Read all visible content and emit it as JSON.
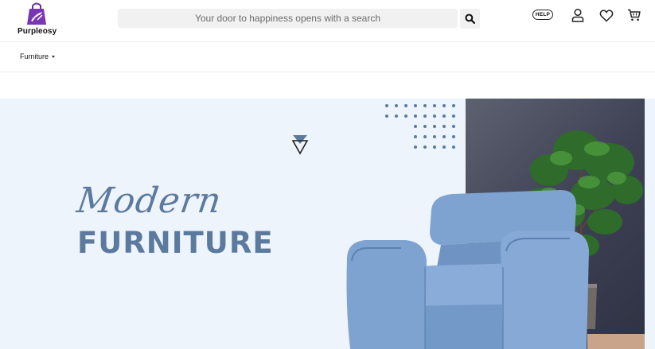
{
  "header": {
    "brand": "Purpleosy",
    "search_placeholder": "Your door to happiness opens with a search",
    "help_label": "HELP",
    "icons": [
      "search-icon",
      "help-icon",
      "user-icon",
      "heart-icon",
      "cart-icon"
    ]
  },
  "nav": {
    "items": [
      {
        "label": "Furniture",
        "has_dropdown": true
      }
    ]
  },
  "hero": {
    "script_text": "Modern",
    "title": "FURNITURE"
  },
  "colors": {
    "brand_purple": "#6b2fa0",
    "hero_bg": "#eef4fb",
    "hero_text": "#5b7a9e",
    "chair_blue": "#7fa3d1",
    "dark_panel": "#3e4154"
  }
}
